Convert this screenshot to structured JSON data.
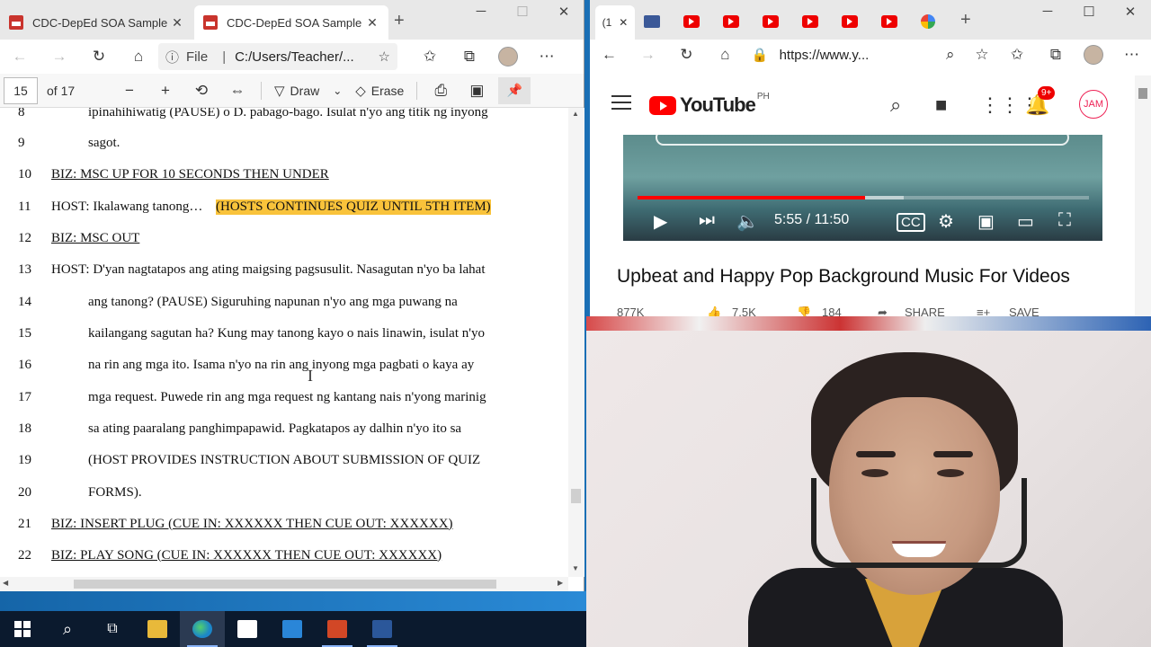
{
  "left_browser": {
    "tabs": [
      {
        "label": "CDC-DepEd SOA Sample M"
      },
      {
        "label": "CDC-DepEd SOA Sample M"
      }
    ],
    "file_label": "File",
    "url": "C:/Users/Teacher/...",
    "pdf_toolbar": {
      "page_current": "15",
      "page_of": "of 17",
      "draw_label": "Draw",
      "erase_label": "Erase"
    },
    "lines": [
      {
        "num": "8",
        "text": "ipinahihiwatig (PAUSE) o D. pabago-bago. Isulat n'yo ang titik ng inyong"
      },
      {
        "num": "9",
        "text": "sagot."
      },
      {
        "num": "10",
        "text": "BIZ: MSC UP FOR 10 SECONDS THEN UNDER"
      },
      {
        "num": "11",
        "text": "HOST: Ikalawang tanong…"
      },
      {
        "num": "12",
        "text": "BIZ: MSC OUT"
      },
      {
        "num": "13",
        "text": "HOST: D'yan nagtatapos ang ating maigsing pagsusulit. Nasagutan n'yo ba lahat"
      },
      {
        "num": "14",
        "text": "ang tanong? (PAUSE) Siguruhing napunan n'yo ang mga puwang na"
      },
      {
        "num": "15",
        "text": "kailangang sagutan ha? Kung may tanong kayo o nais linawin, isulat n'yo"
      },
      {
        "num": "16",
        "text": "na rin ang mga ito. Isama n'yo na rin ang inyong mga pagbati o kaya ay"
      },
      {
        "num": "17",
        "text": "mga request. Puwede rin ang mga request ng kantang nais n'yong marinig"
      },
      {
        "num": "18",
        "text": "sa ating paaralang panghimpapawid. Pagkatapos ay dalhin n'yo ito sa"
      },
      {
        "num": "19",
        "text": "(HOST PROVIDES INSTRUCTION ABOUT SUBMISSION OF QUIZ"
      },
      {
        "num": "20",
        "text": "FORMS)."
      },
      {
        "num": "21",
        "text": "BIZ: INSERT PLUG (CUE IN: XXXXXX THEN CUE OUT: XXXXXX)"
      },
      {
        "num": "22",
        "text": "BIZ: PLAY SONG (CUE IN: XXXXXX THEN CUE OUT: XXXXXX)"
      }
    ],
    "highlight_text": "(HOSTS CONTINUES QUIZ UNTIL 5TH ITEM)"
  },
  "right_browser": {
    "active_tab_label": "(1",
    "url": "https://www.y...",
    "youtube": {
      "logo_text": "YouTube",
      "country_code": "PH",
      "notification_badge": "9+",
      "account_initials": "JAM",
      "time_display": "5:55 / 11:50",
      "progress_fraction": 0.503,
      "buffered_fraction": 0.59,
      "video_title": "Upbeat and Happy Pop Background Music For Videos",
      "views": "877K",
      "likes": "7.5K",
      "dislikes": "184",
      "share_label": "SHARE",
      "save_label": "SAVE"
    }
  },
  "taskbar": {
    "apps": [
      "start",
      "search",
      "task-view",
      "file-explorer",
      "edge",
      "store",
      "mail",
      "powerpoint",
      "word"
    ]
  }
}
